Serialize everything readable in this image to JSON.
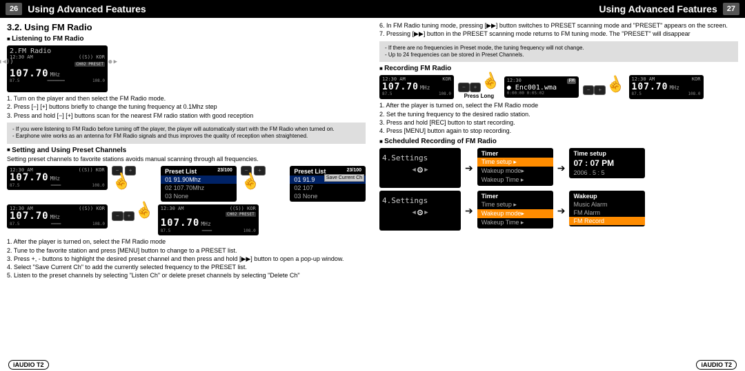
{
  "header": {
    "title": "Using Advanced Features",
    "left_page": "26",
    "right_page": "27"
  },
  "footer": "iAUDIO T2",
  "left": {
    "section": "3.2. Using FM Radio",
    "sub1": "Listening to FM Radio",
    "fm_screen": {
      "title": "2.FM Radio",
      "time": "12:30 AM",
      "battery": "100",
      "chip": "CH02 PRESET",
      "freq": "107.70",
      "unit": "MHz",
      "scale_lo": "87.5",
      "scale_hi": "108.0",
      "kor": "KOR",
      "speaker": "◀))",
      "mute": "◀",
      "rec": "●"
    },
    "steps1": [
      "1. Turn on the player and then select the FM Radio mode.",
      "2. Press [−] [+] buttons briefly to change the tuning frequency at 0.1Mhz step",
      "3. Press and hold [−] [+] buttons scan for the nearest FM radio station with good reception"
    ],
    "note1": [
      "- If you were listening to FM Radio before turning off the player, the player will automatically start with the FM Radio when turned on.",
      "- Earphone wire works as an antenna for FM Radio signals and thus improves the quality of reception when straightened."
    ],
    "sub2": "Setting and Using Preset Channels",
    "intro2": "Setting preset channels to favorite stations avoids manual scanning through all frequencies.",
    "preset_list_hdr": "Preset List",
    "preset_items_a": [
      "01 91.90Mhz",
      "02 107.70Mhz",
      "03 None"
    ],
    "preset_items_b": [
      "01 91.9",
      "02 107",
      "03 None"
    ],
    "save_label": "Save Current Ch",
    "small_freq": "107.70",
    "small_unit": "MHz",
    "steps2": [
      "1. After the player is turned on, select the FM Radio mode",
      "2. Tune to the favorite station and press [MENU] button to change to a PRESET list.",
      "3. Press +, - buttons to highlight the desired preset channel and then press and hold [▶▶] button to open a pop-up window.",
      "4. Select \"Save Current Ch\" to add the currently selected frequency to the PRESET list.",
      "5. Listen to the preset channels by selecting \"Listen Ch\" or delete preset channels by selecting \"Delete Ch\""
    ]
  },
  "right": {
    "steps_top": [
      "6. In FM Radio tuning mode, pressing [▶▶] button switches to PRESET scanning mode and \"PRESET\" appears on the screen.",
      "7. Pressing [▶▶] button in the PRESET scanning mode returns to FM tuning mode. The \"PRESET\" will disappear"
    ],
    "note2": [
      "- If there are no frequencies in Preset mode, the tuning frequency will not change.",
      "- Up to 24 frequencies can be stored in Preset Channels."
    ],
    "sub3": "Recording FM Radio",
    "rec_file": "Enc001.wma",
    "rec_time": "0:00:00  0:05:02",
    "press_long": "Press Long",
    "steps3": [
      "1. After the player is turned on, select the FM Radio mode",
      "2. Set the tuning frequency to the desired radio station.",
      "3. Press and hold [REC] button to start recording.",
      "4. Press [MENU] button again to stop recording."
    ],
    "sub4": "Scheduled Recording of FM Radio",
    "settings_title": "4.Settings",
    "timer_hdr": "Timer",
    "timer_items": [
      "Time setup",
      "Wakeup mode",
      "Wakeup Time"
    ],
    "time_setup_hdr": "Time setup",
    "time_val": "07 : 07 PM",
    "date_val": "2006 . 5 : 5",
    "wakeup_hdr": "Wakeup",
    "wakeup_items": [
      "Music Alarm",
      "FM Alarm",
      "FM Record"
    ]
  }
}
